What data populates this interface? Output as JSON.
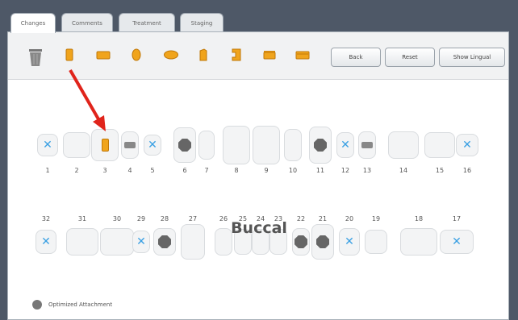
{
  "tabs": [
    {
      "label": "Changes",
      "active": true
    },
    {
      "label": "Comments",
      "active": false
    },
    {
      "label": "Treatment",
      "active": false
    },
    {
      "label": "Staging",
      "active": false
    }
  ],
  "toolbar": {
    "tool_icons": [
      "trash-icon",
      "orange-attachment-tall-icon",
      "orange-attachment-wide-icon",
      "orange-attachment-oval-icon",
      "orange-attachment-ellipse-icon",
      "orange-attachment-beveled-icon",
      "orange-attachment-bracket-icon",
      "orange-attachment-bar-icon",
      "orange-attachment-ridge-icon"
    ],
    "back_label": "Back",
    "reset_label": "Reset",
    "show_lingual_label": "Show Lingual"
  },
  "upper_arch": [
    {
      "number": "1",
      "mark": "x"
    },
    {
      "number": "2",
      "mark": "none"
    },
    {
      "number": "3",
      "mark": "orange"
    },
    {
      "number": "4",
      "mark": "tint"
    },
    {
      "number": "5",
      "mark": "x"
    },
    {
      "number": "6",
      "mark": "octagon"
    },
    {
      "number": "7",
      "mark": "none"
    },
    {
      "number": "8",
      "mark": "none"
    },
    {
      "number": "9",
      "mark": "none"
    },
    {
      "number": "10",
      "mark": "none"
    },
    {
      "number": "11",
      "mark": "octagon"
    },
    {
      "number": "12",
      "mark": "x"
    },
    {
      "number": "13",
      "mark": "tint"
    },
    {
      "number": "14",
      "mark": "none"
    },
    {
      "number": "15",
      "mark": "none"
    },
    {
      "number": "16",
      "mark": "x"
    }
  ],
  "view_label": "Buccal",
  "lower_arch": [
    {
      "number": "32",
      "mark": "x"
    },
    {
      "number": "31",
      "mark": "none"
    },
    {
      "number": "30",
      "mark": "none"
    },
    {
      "number": "29",
      "mark": "x"
    },
    {
      "number": "28",
      "mark": "octagon"
    },
    {
      "number": "27",
      "mark": "none"
    },
    {
      "number": "26",
      "mark": "none"
    },
    {
      "number": "25",
      "mark": "none"
    },
    {
      "number": "24",
      "mark": "none"
    },
    {
      "number": "23",
      "mark": "none"
    },
    {
      "number": "22",
      "mark": "octagon"
    },
    {
      "number": "21",
      "mark": "octagon"
    },
    {
      "number": "20",
      "mark": "x"
    },
    {
      "number": "19",
      "mark": "none"
    },
    {
      "number": "18",
      "mark": "none"
    },
    {
      "number": "17",
      "mark": "x"
    }
  ],
  "legend": {
    "label": "Optimized Attachment",
    "icon": "optimized-attachment-icon"
  },
  "colors": {
    "accent_orange": "#f0a41c",
    "x_blue": "#3aa0e3",
    "arrow_red": "#e0241b",
    "chrome": "#4e5867"
  }
}
